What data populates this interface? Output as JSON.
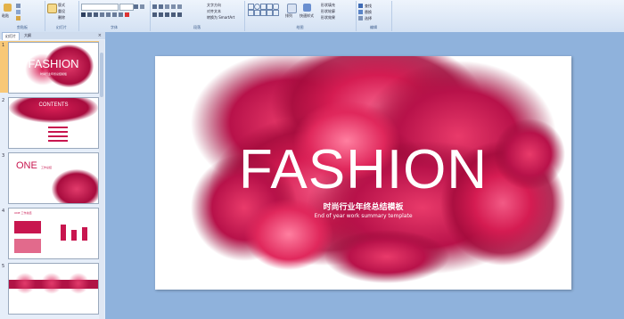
{
  "ribbon": {
    "groups": [
      "剪贴板",
      "幻灯片",
      "字体",
      "段落",
      "绘图",
      "编辑"
    ],
    "clipboard": {
      "paste_label": "粘贴"
    },
    "slides": {
      "new_slide_label": "新建幻灯片",
      "layout_label": "版式",
      "reset_label": "重设",
      "delete_label": "删除"
    },
    "paragraph": {
      "text_direction_label": "文字方向",
      "align_text_label": "对齐文本",
      "smartart_label": "转换为 SmartArt"
    },
    "drawing": {
      "arrange_label": "排列",
      "quick_styles_label": "快速样式",
      "fill_label": "形状填充",
      "outline_label": "形状轮廓",
      "effects_label": "形状效果"
    },
    "editing": {
      "find_label": "查找",
      "replace_label": "替换",
      "select_label": "选择"
    },
    "colors": {
      "accent": "#2b579a"
    }
  },
  "panel": {
    "tabs": {
      "slides": "幻灯片",
      "outline": "大纲"
    },
    "close_glyph": "×",
    "thumbnails": [
      {
        "num": "1",
        "title": "FASHION",
        "subtitle": "时尚行业年终总结模板",
        "selected": true
      },
      {
        "num": "2",
        "title": "CONTENTS",
        "selected": false
      },
      {
        "num": "3",
        "title": "ONE",
        "subtitle": "工作总结",
        "selected": false
      },
      {
        "num": "4",
        "title": "ONE 工作总结",
        "selected": false
      },
      {
        "num": "5",
        "title": "",
        "selected": false
      }
    ]
  },
  "slide": {
    "title": "FASHION",
    "subtitle_cn": "时尚行业年终总结模板",
    "subtitle_en": "End of year work summary template",
    "ink_color": "#c8164f"
  }
}
